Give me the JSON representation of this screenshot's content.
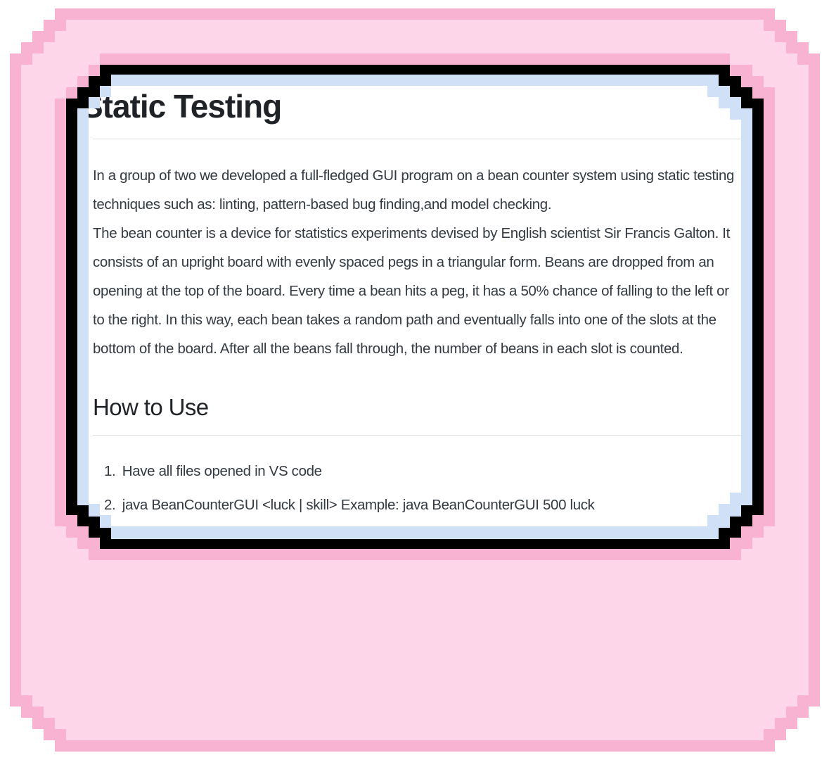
{
  "readme": {
    "title": "Static Testing",
    "intro": "In a group of two we developed a full-fledged GUI program on a bean counter system using static testing techniques such as: linting, pattern-based bug finding,and model checking.",
    "description": "The bean counter is a device for statistics experiments devised by English scientist Sir Francis Galton. It consists of an upright board with evenly spaced pegs in a triangular form. Beans are dropped from an opening at the top of the board. Every time a bean hits a peg, it has a 50% chance of falling to the left or to the right. In this way, each bean takes a random path and eventually falls into one of the slots at the bottom of the board. After all the beans fall through, the number of beans in each slot is counted.",
    "how_to_use": {
      "heading": "How to Use",
      "steps": [
        {
          "num": "1.",
          "text": "Have all files opened in VS code"
        },
        {
          "num": "2.",
          "text": "java BeanCounterGUI <luck | skill> Example: java BeanCounterGUI 500 luck"
        }
      ]
    }
  },
  "colors": {
    "outer_border": "#f7b3d1",
    "outer_fill": "#fdd6e9",
    "frame": "#000000",
    "frame_inner": "#cfe0f7",
    "content_bg": "#ffffff"
  }
}
